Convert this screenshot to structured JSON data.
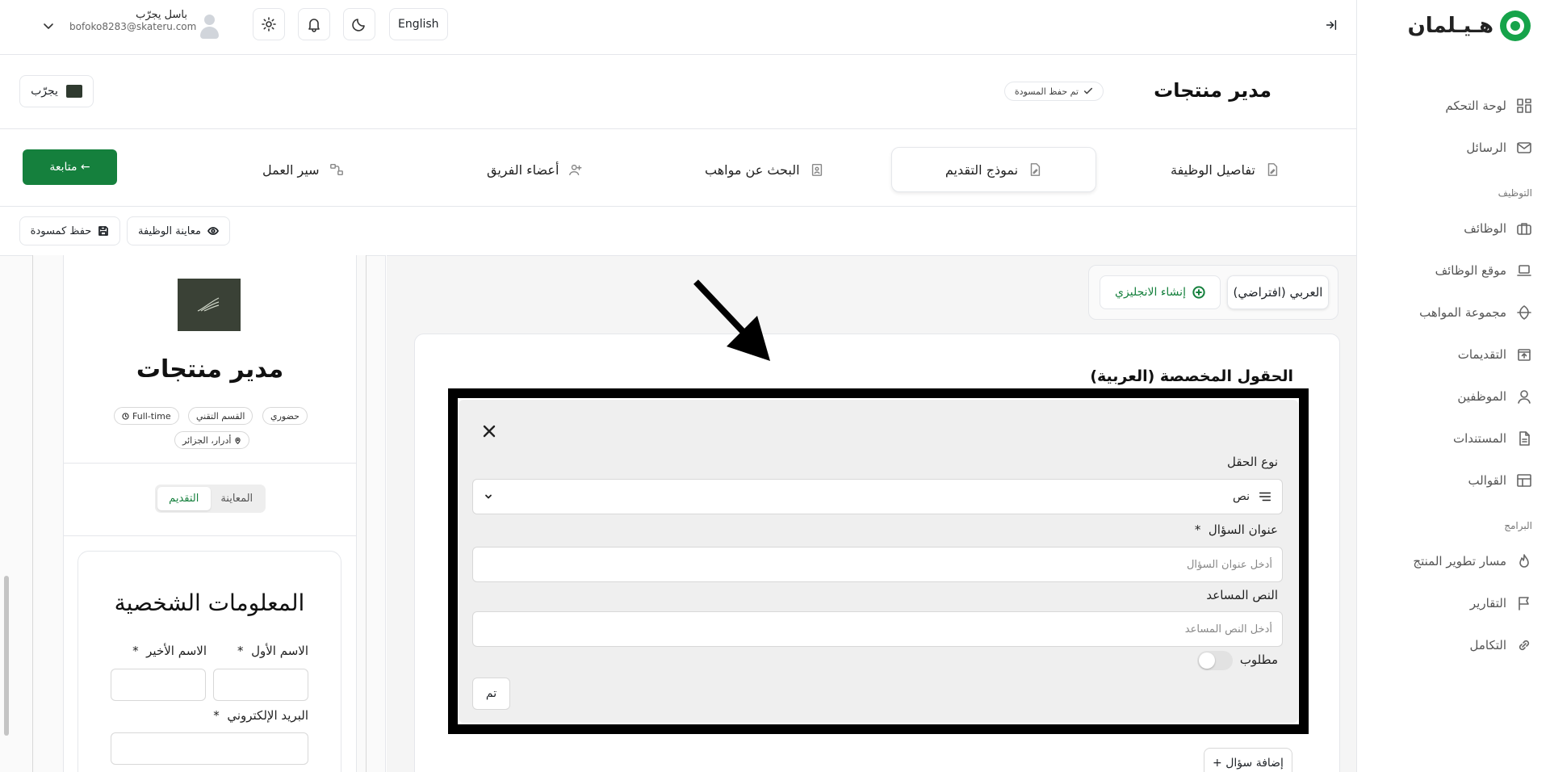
{
  "brand": {
    "name": "هـيـلمان",
    "accent": "#16a34a"
  },
  "sidebar": {
    "items": [
      {
        "label": "لوحة التحكم",
        "icon": "dashboard-icon"
      },
      {
        "label": "الرسائل",
        "icon": "mail-icon"
      },
      {
        "label": "الوظائف",
        "icon": "briefcase-icon"
      },
      {
        "label": "موقع الوظائف",
        "icon": "laptop-icon"
      },
      {
        "label": "مجموعة المواهب",
        "icon": "talent-icon"
      },
      {
        "label": "التقديمات",
        "icon": "inbox-icon"
      },
      {
        "label": "الموظفين",
        "icon": "user-icon"
      },
      {
        "label": "المستندات",
        "icon": "file-icon"
      },
      {
        "label": "القوالب",
        "icon": "template-icon"
      },
      {
        "label": "مسار تطوير المنتج",
        "icon": "flame-icon"
      },
      {
        "label": "التقارير",
        "icon": "flag-icon"
      },
      {
        "label": "التكامل",
        "icon": "link-icon"
      }
    ],
    "section_hiring": "التوظيف",
    "section_programs": "البرامج"
  },
  "header": {
    "language_button": "English",
    "user_name": "باسل يجرّب",
    "user_email": "bofoko8283@skateru.com"
  },
  "page": {
    "title": "مدير منتجات",
    "draft_badge": "تم حفظ المسودة",
    "company_button": "يجرّب"
  },
  "steps": {
    "items": [
      "تفاصيل الوظيفة",
      "نموذج التقديم",
      "البحث عن مواهب",
      "أعضاء الفريق",
      "سير العمل"
    ],
    "active_index": 1,
    "continue_button": "متابعة ←"
  },
  "actions": {
    "preview_job": "معاينة الوظيفة",
    "save_draft": "حفظ كمسودة"
  },
  "preview": {
    "job_title": "مدير منتجات",
    "chips": [
      "حضوري",
      "القسم التقني",
      "Full-time",
      "أدرار، الجزائر"
    ],
    "tabs": [
      "المعاينة",
      "التقديم"
    ],
    "active_tab": "التقديم",
    "form_heading": "المعلومات الشخصية",
    "first_name_label": "الاسم الأول",
    "last_name_label": "الاسم الأخير",
    "email_label": "البريد الإلكتروني",
    "required_mark": "*"
  },
  "editor": {
    "lang_default": "العربي (افتراضي)",
    "create_english": "إنشاء الانجليزي",
    "section_title": "الحقول المخصصة (العربية)",
    "field_type_label": "نوع الحقل",
    "field_type_value": "نص",
    "question_title_label": "عنوان السؤال",
    "question_title_placeholder": "أدخل عنوان السؤال",
    "helper_text_label": "النص المساعد",
    "helper_text_placeholder": "أدخل النص المساعد",
    "required_label": "مطلوب",
    "required_on": false,
    "required_mark": "*",
    "done_button": "تم",
    "add_question_button": "+ إضافة سؤال"
  }
}
